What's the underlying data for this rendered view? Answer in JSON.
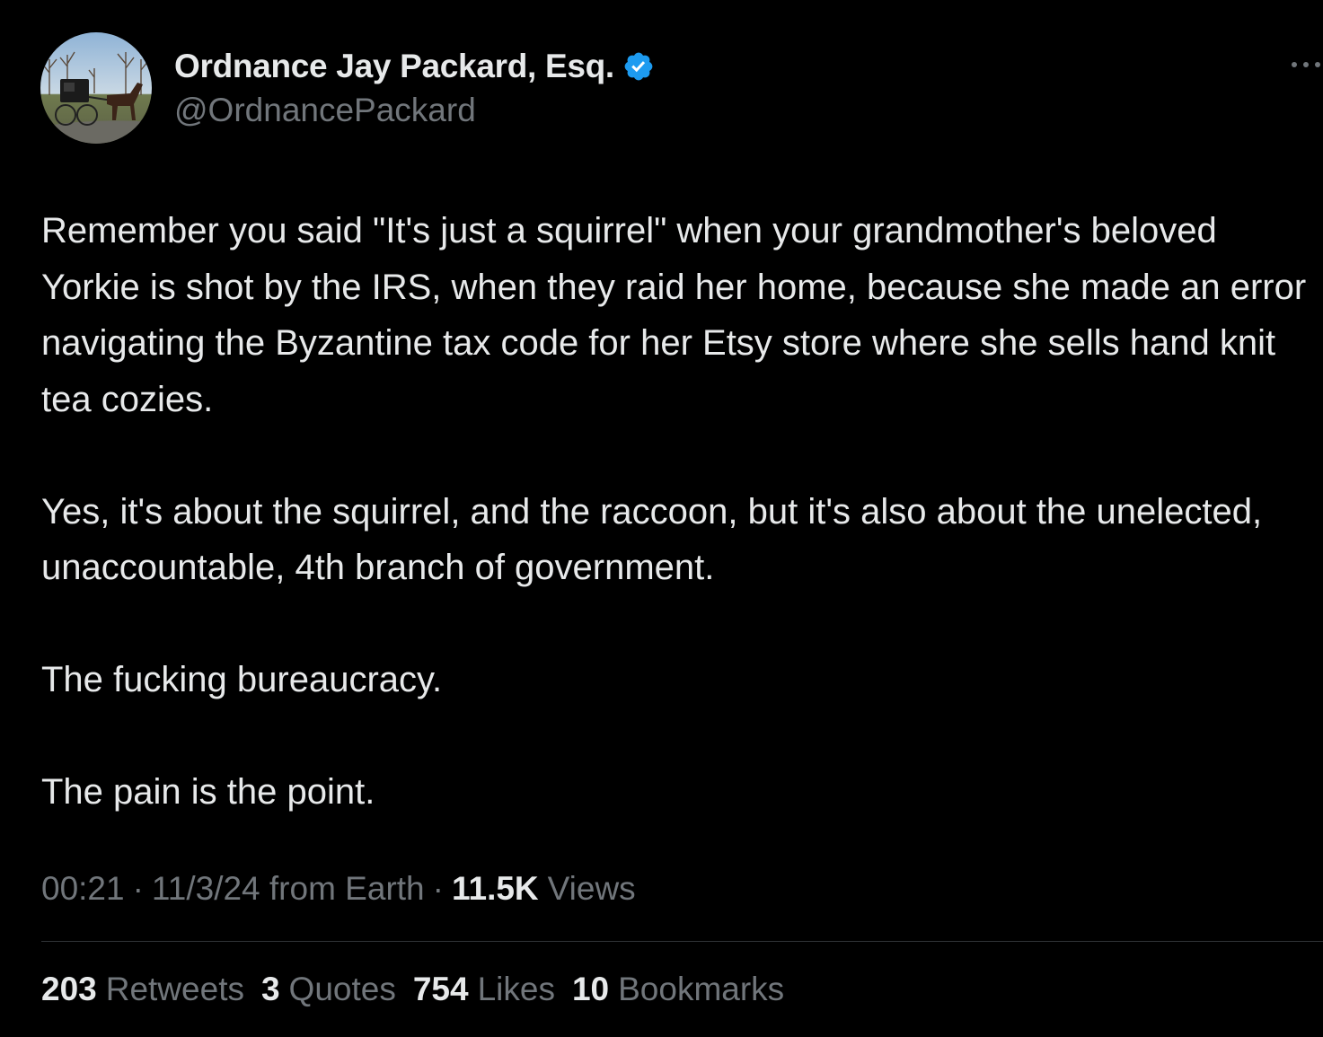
{
  "author": {
    "display_name": "Ordnance Jay Packard, Esq.",
    "handle": "@OrdnancePackard",
    "verified": true,
    "verified_color": "#1d9bf0"
  },
  "tweet": {
    "paragraphs": [
      "Remember you said \"It's just a squirrel\" when your grandmother's beloved Yorkie is shot by the IRS, when they raid her home, because she made an error navigating the Byzantine tax code for her Etsy store where she sells hand knit tea cozies.",
      "Yes, it's about the squirrel, and the raccoon, but it's also about the unelected, unaccountable, 4th branch of government.",
      "The fucking bureaucracy.",
      "The pain is the point."
    ]
  },
  "meta": {
    "time": "00:21",
    "date": "11/3/24 from Earth",
    "separator": "·",
    "views_count": "11.5K",
    "views_label": "Views"
  },
  "stats": [
    {
      "count": "203",
      "label": "Retweets"
    },
    {
      "count": "3",
      "label": "Quotes"
    },
    {
      "count": "754",
      "label": "Likes"
    },
    {
      "count": "10",
      "label": "Bookmarks"
    }
  ],
  "colors": {
    "background": "#000000",
    "primary_text": "#e7e9ea",
    "secondary_text": "#71767b",
    "divider": "#2f3336"
  },
  "icons": {
    "verified": "verified-badge-icon",
    "more": "more-options-icon"
  }
}
